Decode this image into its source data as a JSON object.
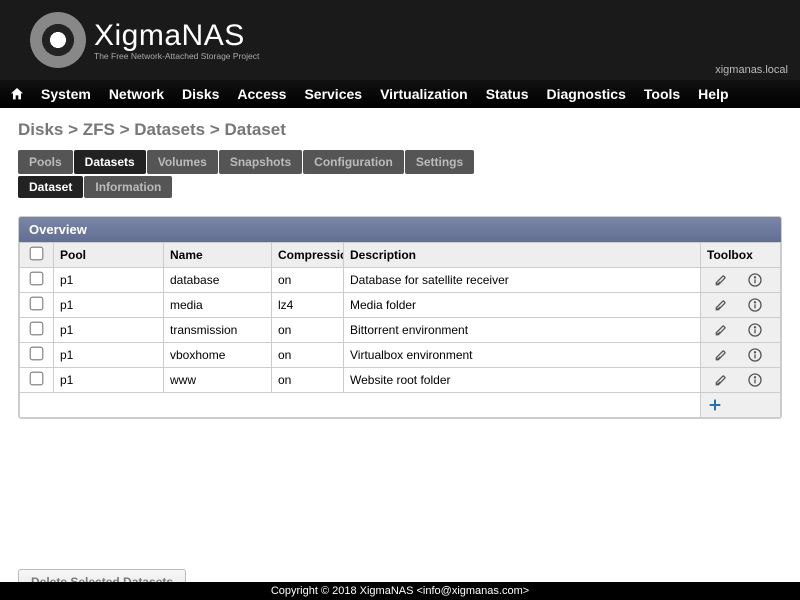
{
  "brand": {
    "name": "XigmaNAS",
    "tagline": "The Free Network-Attached Storage Project"
  },
  "hostname": "xigmanas.local",
  "menu": [
    "System",
    "Network",
    "Disks",
    "Access",
    "Services",
    "Virtualization",
    "Status",
    "Diagnostics",
    "Tools",
    "Help"
  ],
  "breadcrumb": "Disks > ZFS > Datasets > Dataset",
  "tabs": {
    "primary": [
      "Pools",
      "Datasets",
      "Volumes",
      "Snapshots",
      "Configuration",
      "Settings"
    ],
    "primary_active": 1,
    "secondary": [
      "Dataset",
      "Information"
    ],
    "secondary_active": 0
  },
  "panel_title": "Overview",
  "columns": {
    "pool": "Pool",
    "name": "Name",
    "compression": "Compression",
    "description": "Description",
    "toolbox": "Toolbox"
  },
  "rows": [
    {
      "pool": "p1",
      "name": "database",
      "compression": "on",
      "description": "Database for satellite receiver"
    },
    {
      "pool": "p1",
      "name": "media",
      "compression": "lz4",
      "description": "Media folder"
    },
    {
      "pool": "p1",
      "name": "transmission",
      "compression": "on",
      "description": "Bittorrent environment"
    },
    {
      "pool": "p1",
      "name": "vboxhome",
      "compression": "on",
      "description": "Virtualbox environment"
    },
    {
      "pool": "p1",
      "name": "www",
      "compression": "on",
      "description": "Website root folder"
    }
  ],
  "delete_button": "Delete Selected Datasets",
  "copyright": "Copyright © 2018 XigmaNAS <info@xigmanas.com>"
}
